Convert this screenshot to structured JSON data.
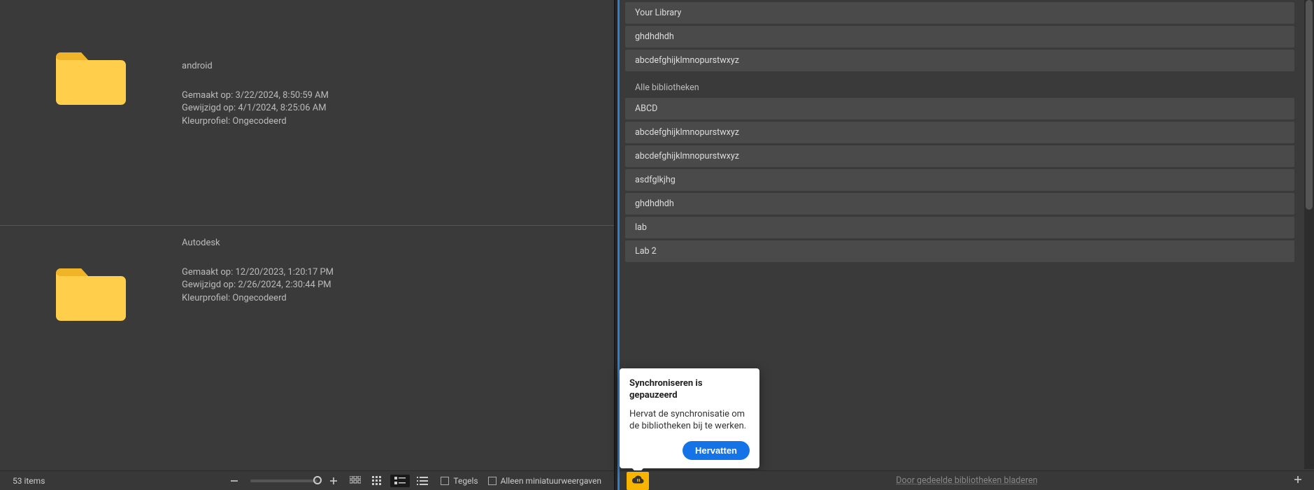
{
  "left": {
    "items": [
      {
        "name": "android",
        "created_label": "Gemaakt op:",
        "created": "3/22/2024, 8:50:59 AM",
        "modified_label": "Gewijzigd op:",
        "modified": "4/1/2024, 8:25:06 AM",
        "color_profile_label": "Kleurprofiel:",
        "color_profile": "Ongecodeerd"
      },
      {
        "name": "Autodesk",
        "created_label": "Gemaakt op:",
        "created": "12/20/2023, 1:20:17 PM",
        "modified_label": "Gewijzigd op:",
        "modified": "2/26/2024, 2:30:44 PM",
        "color_profile_label": "Kleurprofiel:",
        "color_profile": "Ongecodeerd"
      }
    ],
    "statusbar": {
      "count": "53 items",
      "tiles_label": "Tegels",
      "thumb_only_label": "Alleen miniatuurweergaven"
    }
  },
  "right": {
    "groups": {
      "top": {
        "items": [
          "Your Library",
          "ghdhdhdh",
          "abcdefghijklmnopurstwxyz"
        ]
      },
      "all": {
        "heading": "Alle bibliotheken",
        "items": [
          "ABCD",
          "abcdefghijklmnopurstwxyz",
          "abcdefghijklmnopurstwxyz",
          "asdfglkjhg",
          "ghdhdhdh",
          "lab",
          "Lab 2"
        ]
      }
    },
    "popover": {
      "title": "Synchroniseren is gepauzeerd",
      "body": "Hervat de synchronisatie om de bibliotheken bij te werken.",
      "action": "Hervatten"
    },
    "statusbar": {
      "browse": "Door gedeelde bibliotheken bladeren"
    }
  }
}
